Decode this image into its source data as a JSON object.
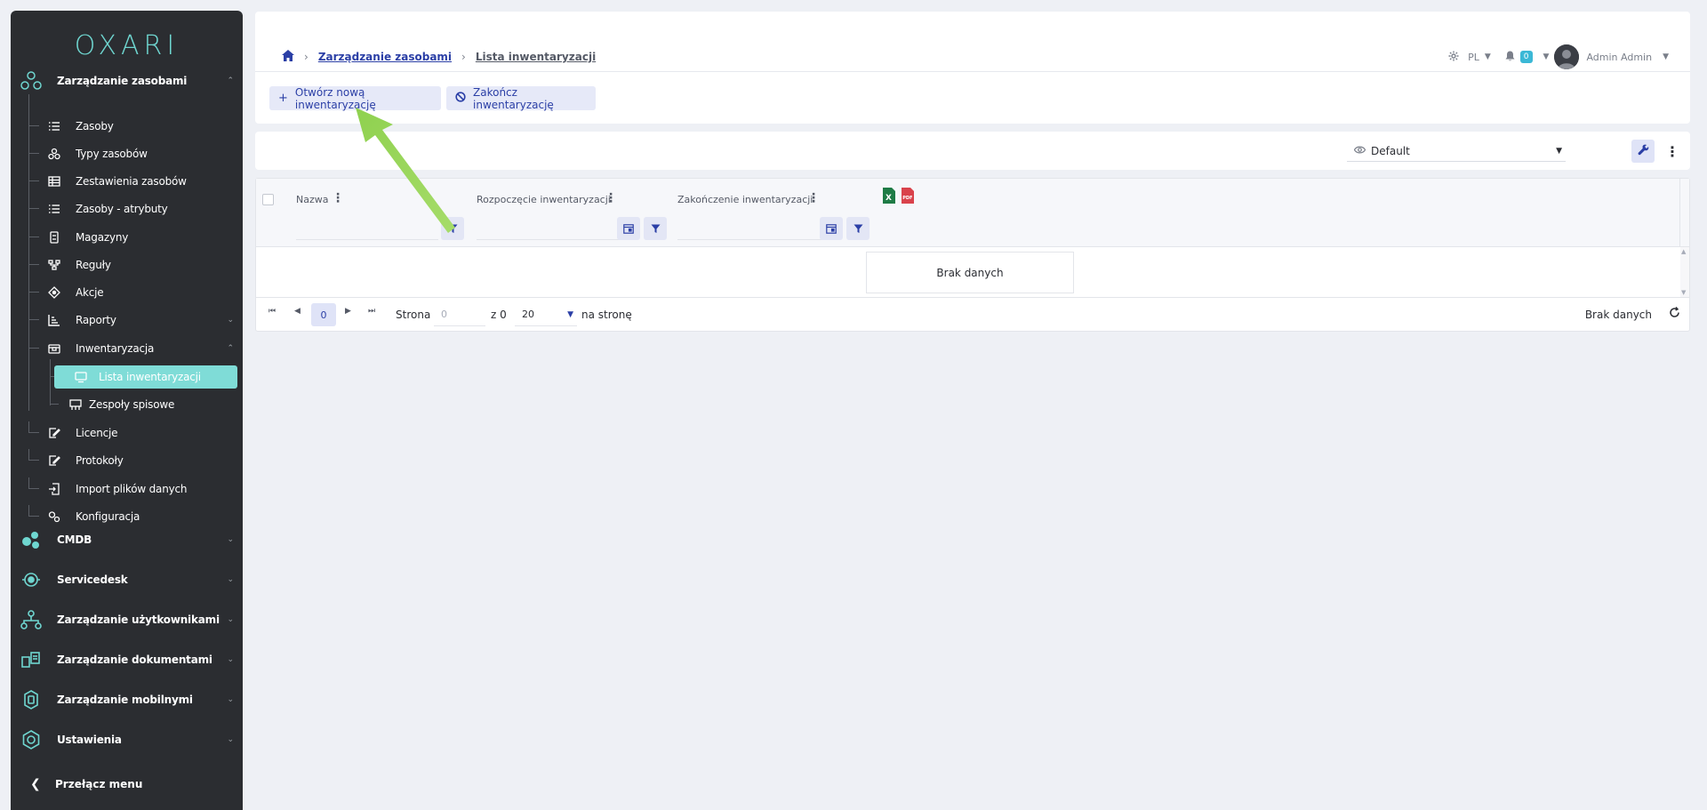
{
  "sidebar": {
    "logo": "OXARI",
    "sections_top": [
      {
        "label": "Zarządzanie zasobami",
        "icon": "molecule-icon",
        "expanded": true
      }
    ],
    "items": [
      {
        "label": "Zasoby",
        "icon": "list-icon"
      },
      {
        "label": "Typy zasobów",
        "icon": "types-icon"
      },
      {
        "label": "Zestawienia zasobów",
        "icon": "table-icon"
      },
      {
        "label": "Zasoby - atrybuty",
        "icon": "list-icon"
      },
      {
        "label": "Magazyny",
        "icon": "warehouse-icon"
      },
      {
        "label": "Reguły",
        "icon": "rules-icon"
      },
      {
        "label": "Akcje",
        "icon": "actions-icon"
      },
      {
        "label": "Raporty",
        "icon": "chart-icon"
      },
      {
        "label": "Inwentaryzacja",
        "icon": "inventory-icon"
      },
      {
        "label": "Licencje",
        "icon": "license-icon"
      },
      {
        "label": "Protokoły",
        "icon": "protocol-icon"
      },
      {
        "label": "Import plików danych",
        "icon": "import-icon"
      },
      {
        "label": "Konfiguracja",
        "icon": "config-icon"
      }
    ],
    "subitems": [
      {
        "label": "Lista inwentaryzacji",
        "icon": "monitor-icon",
        "active": true
      },
      {
        "label": "Zespoły spisowe",
        "icon": "team-icon",
        "active": false
      }
    ],
    "sections": [
      {
        "label": "CMDB",
        "icon": "cmdb-icon"
      },
      {
        "label": "Servicedesk",
        "icon": "servicedesk-icon"
      },
      {
        "label": "Zarządzanie użytkownikami",
        "icon": "users-icon"
      },
      {
        "label": "Zarządzanie dokumentami",
        "icon": "documents-icon"
      },
      {
        "label": "Zarządzanie mobilnymi",
        "icon": "mobile-icon"
      },
      {
        "label": "Ustawienia",
        "icon": "settings-icon"
      }
    ],
    "toggle_label": "Przełącz menu"
  },
  "header": {
    "breadcrumb": [
      "Zarządzanie zasobami",
      "Lista inwentaryzacji"
    ],
    "language": "PL",
    "notifications": "0",
    "user": "Admin Admin"
  },
  "actions": {
    "open_label": "Otwórz nową inwentaryzację",
    "close_label": "Zakończ inwentaryzację"
  },
  "toolbar": {
    "view": "Default"
  },
  "grid": {
    "columns": [
      "Nazwa",
      "Rozpoczęcie inwentaryzacji",
      "Zakończenie inwentaryzacji"
    ],
    "empty_text": "Brak danych",
    "export_icons": [
      "excel-icon",
      "pdf-icon"
    ]
  },
  "pager": {
    "current_page": "0",
    "page_label": "Strona",
    "page_input": "0",
    "of_label": "z 0",
    "page_size": "20",
    "per_page_label": "na stronę",
    "status": "Brak danych"
  },
  "colors": {
    "accent": "#2b3fa6",
    "sidebar_bg": "#2b2d31",
    "active_item": "#7fdcd7",
    "logo": "#6fd6d0",
    "arrow": "#8fd14f"
  }
}
